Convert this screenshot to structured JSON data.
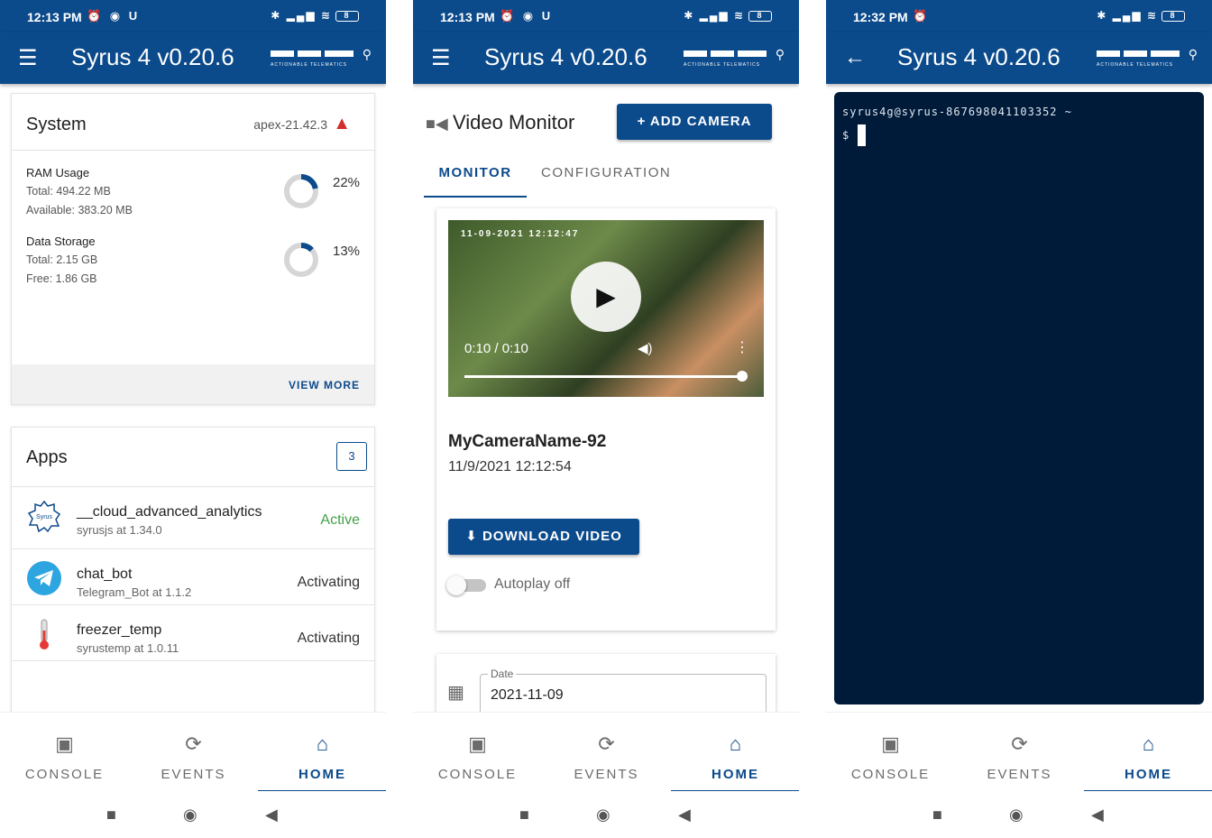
{
  "phones": [
    {
      "status": {
        "time": "12:13 PM",
        "left_icons": "⏰ ◉ U",
        "right_icons": "✱ ▂▄▆ ≋",
        "battery": "8"
      },
      "appbar": {
        "title": "Syrus 4 v0.20.6",
        "leading": "☰",
        "logo_tag": "ACTIONABLE TELEMATICS"
      },
      "nav": [
        {
          "icon": "▣",
          "label": "CONSOLE"
        },
        {
          "icon": "⟳",
          "label": "EVENTS"
        },
        {
          "icon": "⌂",
          "label": "HOME"
        }
      ]
    },
    {
      "status": {
        "time": "12:13 PM",
        "left_icons": "⏰ ◉ U",
        "right_icons": "✱ ▂▄▆ ≋",
        "battery": "8"
      },
      "appbar": {
        "title": "Syrus 4 v0.20.6",
        "leading": "☰",
        "logo_tag": "ACTIONABLE TELEMATICS"
      },
      "nav": [
        {
          "icon": "▣",
          "label": "CONSOLE"
        },
        {
          "icon": "⟳",
          "label": "EVENTS"
        },
        {
          "icon": "⌂",
          "label": "HOME"
        }
      ]
    },
    {
      "status": {
        "time": "12:32 PM",
        "left_icons": "⏰",
        "right_icons": "✱ ▂▄▆ ≋",
        "battery": "8"
      },
      "appbar": {
        "title": "Syrus 4 v0.20.6",
        "leading": "←",
        "logo_tag": "ACTIONABLE TELEMATICS"
      },
      "nav": [
        {
          "icon": "▣",
          "label": "CONSOLE"
        },
        {
          "icon": "⟳",
          "label": "EVENTS"
        },
        {
          "icon": "⌂",
          "label": "HOME"
        }
      ]
    }
  ],
  "active_nav": "HOME",
  "system": {
    "title": "System",
    "version": "apex-21.42.3",
    "warning_icon": "warning-icon",
    "metrics": [
      {
        "name": "RAM Usage",
        "line1": "Total: 494.22 MB",
        "line2": "Available: 383.20 MB",
        "percent": "22%",
        "fraction": 0.22
      },
      {
        "name": "Data Storage",
        "line1": "Total: 2.15 GB",
        "line2": "Free: 1.86 GB",
        "percent": "13%",
        "fraction": 0.13
      }
    ],
    "view_more": "VIEW MORE"
  },
  "apps": {
    "title": "Apps",
    "count": "3",
    "items": [
      {
        "name": "__cloud_advanced_analytics",
        "sub": "syrusjs at 1.34.0",
        "status": "Active",
        "icon": "syrus-logo-icon",
        "logo_text": "Syrus"
      },
      {
        "name": "chat_bot",
        "sub": "Telegram_Bot at 1.1.2",
        "status": "Activating",
        "icon": "telegram-icon"
      },
      {
        "name": "freezer_temp",
        "sub": "syrustemp at 1.0.11",
        "status": "Activating",
        "icon": "thermometer-icon"
      }
    ]
  },
  "video": {
    "title": "Video Monitor",
    "add_camera": "+ ADD CAMERA",
    "tabs": [
      "MONITOR",
      "CONFIGURATION"
    ],
    "stamp": "11-09-2021 12:12:47",
    "time": "0:10 / 0:10",
    "progress": 1.0,
    "camera_name": "MyCameraName-92",
    "camera_time": "11/9/2021 12:12:54",
    "download": "⬇ DOWNLOAD VIDEO",
    "autoplay": "Autoplay off",
    "date_label": "Date",
    "date_value": "2021-11-09"
  },
  "terminal": {
    "prompt_line": "syrus4g@syrus-867698041103352 ~",
    "input_line": "$"
  },
  "colors": {
    "primary": "#0b4a8b",
    "terminal_bg": "#001a3a",
    "active": "#43a047",
    "warning": "#d32f2f"
  }
}
